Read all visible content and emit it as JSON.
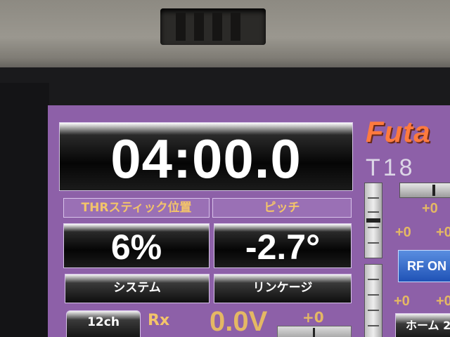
{
  "timer": {
    "value": "04:00.0"
  },
  "throttle": {
    "label": "THRスティック位置",
    "value": "6%"
  },
  "pitch": {
    "label": "ピッチ",
    "value": "-2.7°"
  },
  "buttons": {
    "system": "システム",
    "linkage": "リンケージ",
    "channels": "12ch",
    "rf": "RF ON",
    "home": "ホーム 2"
  },
  "receiver": {
    "label": "Rx",
    "voltage": "0.0V",
    "trim": "+0"
  },
  "brand": {
    "name": "Futa",
    "model": "T18"
  },
  "trims": [
    "+0",
    "+0",
    "+0",
    "+0",
    "+0"
  ],
  "colors": {
    "screen": "#8d60a8",
    "label_text": "#f3c46a",
    "brand": "#ff7a3e",
    "rf_button": "#2f64c8"
  }
}
